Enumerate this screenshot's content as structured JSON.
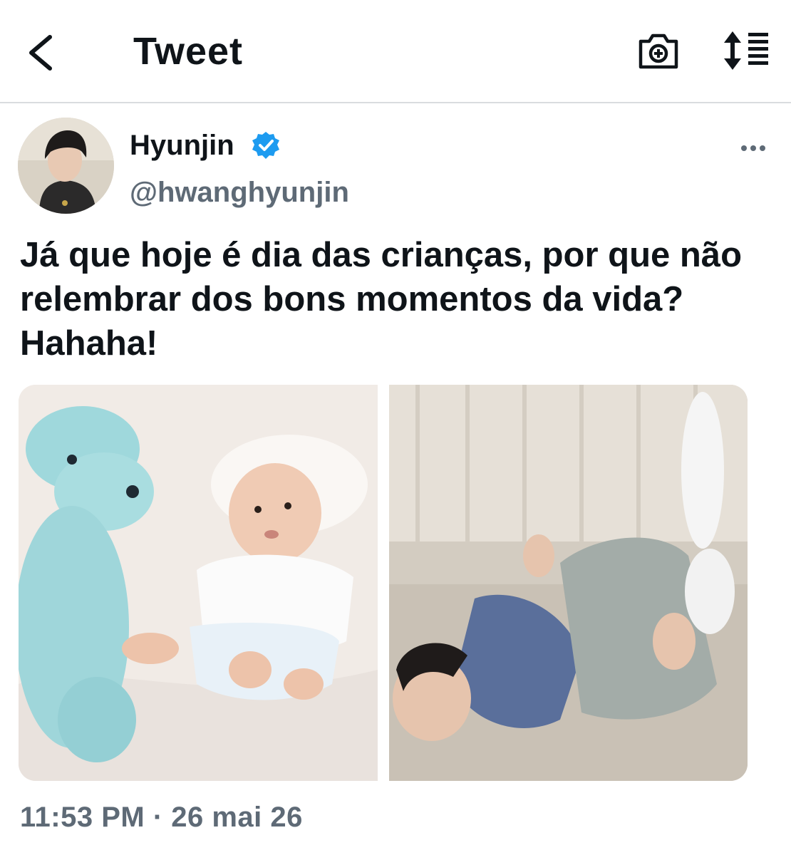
{
  "header": {
    "title": "Tweet",
    "back_icon": "chevron-left-icon",
    "camera_icon": "camera-add-icon",
    "sort_icon": "sort-lines-icon"
  },
  "tweet": {
    "display_name": "Hyunjin",
    "handle": "@hwanghyunjin",
    "verified": true,
    "verified_color": "#1d9bf0",
    "text": "Já que hoje é dia das crianças, por que não relembrar dos bons momentos da vida? Hahaha!",
    "timestamp": "11:53 PM · 26 mai 26",
    "media_count": 2
  },
  "colors": {
    "text_primary": "#0f1419",
    "text_secondary": "#5e6a76",
    "divider": "#d9dcdf",
    "accent": "#1d9bf0"
  }
}
